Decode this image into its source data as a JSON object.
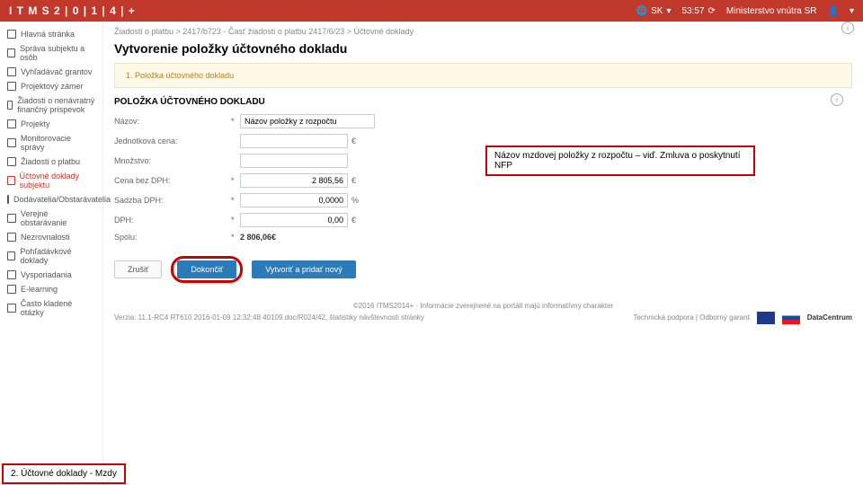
{
  "topbar": {
    "logo": "I T M S  2 | 0 | 1 | 4 | +",
    "lang": "SK",
    "time": "53:57",
    "ministry": "Ministerstvo vnútra SR"
  },
  "sidebar": {
    "items": [
      {
        "label": "Hlavná stránka"
      },
      {
        "label": "Správa subjektu a osôb"
      },
      {
        "label": "Vyhľadávač grantov"
      },
      {
        "label": "Projektový zámer"
      },
      {
        "label": "Žiadosti o nenávratný finančný príspevok"
      },
      {
        "label": "Projekty"
      },
      {
        "label": "Monitorovacie správy"
      },
      {
        "label": "Žiadosti o platbu"
      },
      {
        "label": "Účtovné doklady subjektu",
        "active": true
      },
      {
        "label": "Dodávatelia/Obstarávatelia"
      },
      {
        "label": "Verejné obstarávanie"
      },
      {
        "label": "Nezrovnalosti"
      },
      {
        "label": "Pohľadávkové doklady"
      },
      {
        "label": "Vysporiadania"
      },
      {
        "label": "E-learning"
      },
      {
        "label": "Často kladené otázky"
      }
    ]
  },
  "breadcrumb": "Žiadosti o platbu  >  2417/b723 - Časť žiadosti o platbu 2417/6/23  >  Účtovné doklady",
  "page_title": "Vytvorenie položky účtovného dokladu",
  "step": "1. Položka účtovného dokladu",
  "section": "POLOŽKA ÚČTOVNÉHO DOKLADU",
  "form": {
    "nazov": {
      "label": "Názov:",
      "value": "Názov položky z rozpočtu"
    },
    "jedn_cena": {
      "label": "Jednotková cena:",
      "value": "",
      "unit": "€"
    },
    "mnozstvo": {
      "label": "Množstvo:",
      "value": ""
    },
    "cena_bez_dph": {
      "label": "Cena bez DPH:",
      "value": "2 805,56",
      "unit": "€"
    },
    "sadzba_dph": {
      "label": "Sadzba DPH:",
      "value": "0,0000",
      "unit": "%"
    },
    "dph": {
      "label": "DPH:",
      "value": "0,00",
      "unit": "€"
    },
    "spolu": {
      "label": "Spolu:",
      "value": "2 806,06€"
    }
  },
  "buttons": {
    "zrusit": "Zrušiť",
    "dokoncit": "Dokončiť",
    "vytvorit": "Vytvoriť a pridať nový"
  },
  "callouts": {
    "c1": "Názov mzdovej položky z rozpočtu – viď. Zmluva o poskytnutí NFP",
    "c2": "2. Účtovné doklady - Mzdy"
  },
  "footer": {
    "copy": "©2016 ITMS2014+",
    "info": "Informácie zverejnené na portáli majú informatívny charakter",
    "links": "Technická podpora  |  Odborný garant",
    "verzia": "Verzia: 11.1-RC4 RT610 2016-01-09 12:32:48 40109 doc/R024/42, štatistiky návštevnosti stránky",
    "dc": "DataCentrum"
  }
}
